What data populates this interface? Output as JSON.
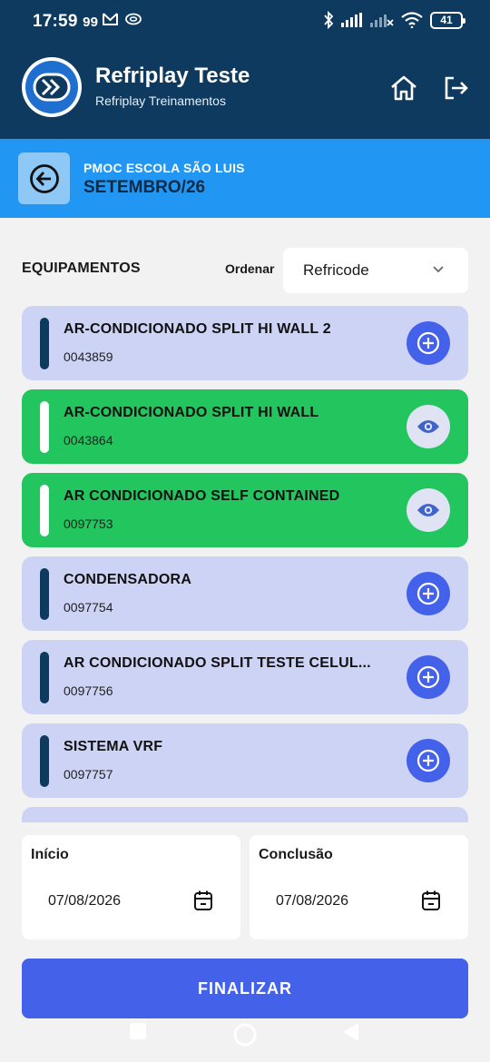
{
  "status_bar": {
    "time": "17:59",
    "badge": "99",
    "battery": "41"
  },
  "app": {
    "title": "Refriplay Teste",
    "subtitle": "Refriplay Treinamentos"
  },
  "context": {
    "line1": "PMOC ESCOLA SÃO LUIS",
    "line2": "SETEMBRO/26"
  },
  "list_header": {
    "title": "EQUIPAMENTOS",
    "order_label": "Ordenar",
    "order_value": "Refricode"
  },
  "equipments": [
    {
      "name": "AR-CONDICIONADO SPLIT HI WALL 2",
      "code": "0043859",
      "state": "pending",
      "action_icon": "plus-circle-icon"
    },
    {
      "name": "AR-CONDICIONADO SPLIT HI WALL",
      "code": "0043864",
      "state": "done",
      "action_icon": "eye-icon"
    },
    {
      "name": "AR CONDICIONADO SELF CONTAINED",
      "code": "0097753",
      "state": "done",
      "action_icon": "eye-icon"
    },
    {
      "name": "CONDENSADORA",
      "code": "0097754",
      "state": "pending",
      "action_icon": "plus-circle-icon"
    },
    {
      "name": "AR CONDICIONADO SPLIT TESTE CELUL...",
      "code": "0097756",
      "state": "pending",
      "action_icon": "plus-circle-icon"
    },
    {
      "name": "SISTEMA VRF",
      "code": "0097757",
      "state": "pending",
      "action_icon": "plus-circle-icon"
    },
    {
      "name": "",
      "code": "",
      "state": "pending",
      "action_icon": ""
    }
  ],
  "dates": {
    "start_label": "Início",
    "start_value": "07/08/2026",
    "end_label": "Conclusão",
    "end_value": "07/08/2026"
  },
  "actions": {
    "finish_label": "FINALIZAR"
  },
  "colors": {
    "header": "#0e3a5f",
    "subheader": "#2196f3",
    "pending_card": "#cdd3f5",
    "done_card": "#22c55e",
    "primary": "#4461ea"
  }
}
